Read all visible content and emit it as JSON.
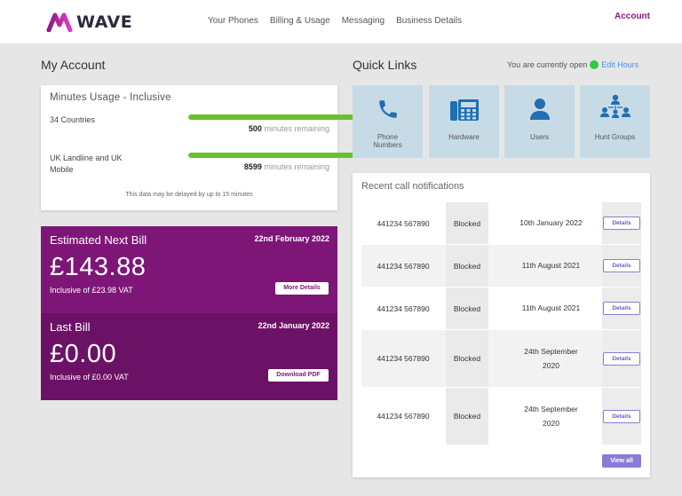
{
  "brand": {
    "name": "WAVE",
    "account_label": "Account"
  },
  "nav": [
    "Your Phones",
    "Billing & Usage",
    "Messaging",
    "Business Details"
  ],
  "my_account": {
    "title": "My Account",
    "usage": {
      "title": "Minutes Usage - Inclusive",
      "rows": [
        {
          "label": "34 Countries",
          "remaining": "500",
          "suffix": "minutes remaining",
          "fill_fraction": 1.0
        },
        {
          "label": "UK Landline and UK Mobile",
          "remaining": "8599",
          "suffix": "minutes remaining",
          "fill_fraction": 1.0
        }
      ],
      "note": "This data may be delayed by up to 15 minutes"
    },
    "estimated_bill": {
      "label": "Estimated Next Bill",
      "date": "22nd February 2022",
      "amount": "£143.88",
      "vat": "Inclusive of £23.98 VAT",
      "button": "More Details"
    },
    "last_bill": {
      "label": "Last Bill",
      "date": "22nd January 2022",
      "amount": "£0.00",
      "vat": "Inclusive of £0.00 VAT",
      "button": "Download PDF"
    }
  },
  "quick_links": {
    "title": "Quick Links",
    "status_text": "You are currently open",
    "edit_hours": "Edit Hours",
    "tiles": [
      {
        "label": "Phone Numbers",
        "icon": "phone-icon"
      },
      {
        "label": "Hardware",
        "icon": "desk-phone-icon"
      },
      {
        "label": "Users",
        "icon": "user-icon"
      },
      {
        "label": "Hunt Groups",
        "icon": "group-icon"
      }
    ]
  },
  "recent_calls": {
    "title": "Recent call notifications",
    "details_label": "Details",
    "view_all": "View all",
    "rows": [
      {
        "number": "441234 567890",
        "status": "Blocked",
        "date": "10th January 2022"
      },
      {
        "number": "441234 567890",
        "status": "Blocked",
        "date": "11th August 2021"
      },
      {
        "number": "441234 567890",
        "status": "Blocked",
        "date": "11th August 2021"
      },
      {
        "number": "441234 567890",
        "status": "Blocked",
        "date": "24th September 2020"
      },
      {
        "number": "441234 567890",
        "status": "Blocked",
        "date": "24th September 2020"
      }
    ]
  },
  "colors": {
    "brand_purple": "#7e1678",
    "accent_blue": "#4a90e2",
    "tile_blue": "#c7dbe6",
    "usage_green": "#6abf2a",
    "status_green": "#2ecc40",
    "button_violet": "#8c7ad6"
  }
}
